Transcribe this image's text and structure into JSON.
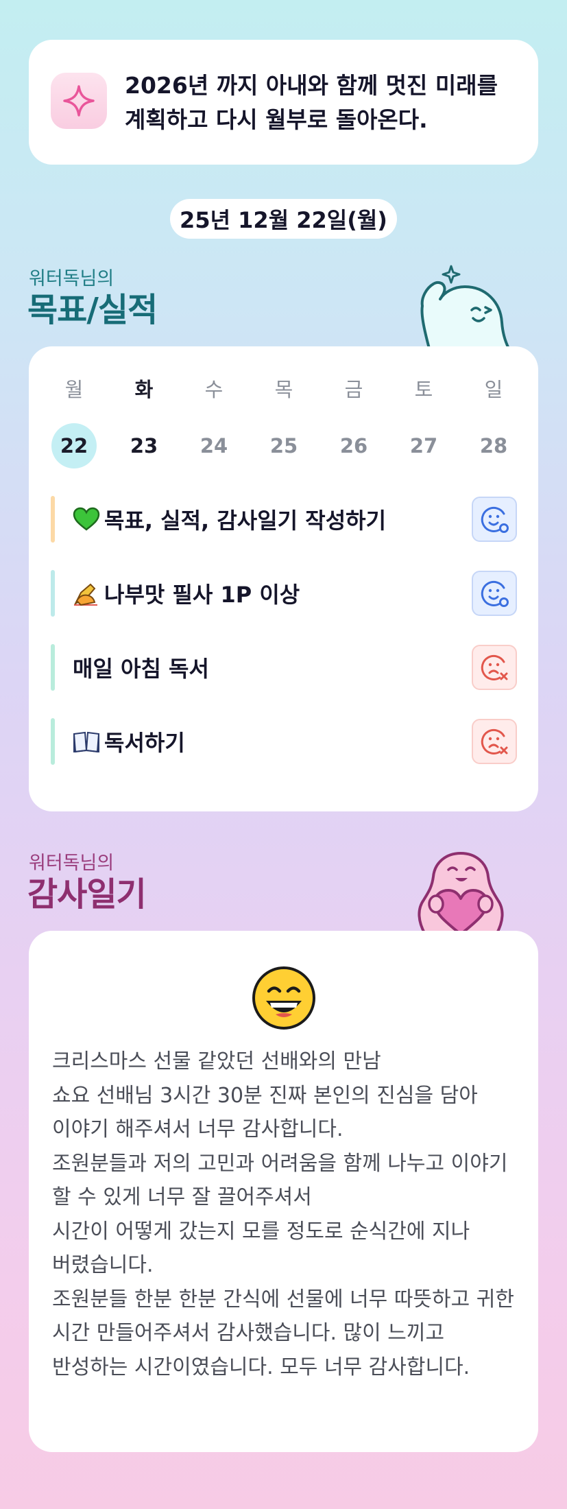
{
  "vision": {
    "icon": "sparkle-icon",
    "text": "2026년 까지 아내와 함께 멋진 미래를 계획하고 다시 월부로 돌아온다."
  },
  "date_label": "25년 12월 22일(월)",
  "goal_section": {
    "subtitle": "워터독님의",
    "title": "목표/실적"
  },
  "week": {
    "days": [
      {
        "name": "월",
        "num": "22",
        "selected": true,
        "today": false
      },
      {
        "name": "화",
        "num": "23",
        "selected": false,
        "today": true
      },
      {
        "name": "수",
        "num": "24",
        "selected": false,
        "today": false
      },
      {
        "name": "목",
        "num": "25",
        "selected": false,
        "today": false
      },
      {
        "name": "금",
        "num": "26",
        "selected": false,
        "today": false
      },
      {
        "name": "토",
        "num": "27",
        "selected": false,
        "today": false
      },
      {
        "name": "일",
        "num": "28",
        "selected": false,
        "today": false
      }
    ]
  },
  "goals": [
    {
      "emoji": "green-heart-icon",
      "label": "목표, 실적, 감사일기 작성하기",
      "bar_color": "#fcd9a6",
      "status": "success"
    },
    {
      "emoji": "writing-hand-icon",
      "label": "나부맛 필사 1P 이상",
      "bar_color": "#bdeaea",
      "status": "success"
    },
    {
      "emoji": "",
      "label": "매일 아침 독서",
      "bar_color": "#b9ecdc",
      "status": "fail"
    },
    {
      "emoji": "open-book-icon",
      "label": "독서하기",
      "bar_color": "#b9ecdc",
      "status": "fail"
    }
  ],
  "gratitude_section": {
    "subtitle": "워터독님의",
    "title": "감사일기"
  },
  "gratitude": {
    "mood_icon": "grinning-face-icon",
    "text": "크리스마스 선물 같았던 선배와의 만남\n쇼요 선배님 3시간 30분 진짜 본인의 진심을 담아 이야기 해주셔서 너무 감사합니다.\n조원분들과 저의 고민과 어려움을 함께 나누고 이야기 할 수 있게 너무 잘 끌어주셔서\n시간이 어떻게 갔는지 모를 정도로 순식간에 지나 버렸습니다.\n조원분들 한분 한분 간식에 선물에 너무 따뜻하고 귀한 시간 만들어주셔서 감사했습니다. 많이 느끼고 반성하는 시간이였습니다. 모두 너무 감사합니다."
  },
  "colors": {
    "goal_title": "#176c77",
    "gratitude_title": "#8e2f6f",
    "selected_day_bg": "#c4eff4",
    "success": "#3b6fe0",
    "fail": "#e2574c"
  }
}
